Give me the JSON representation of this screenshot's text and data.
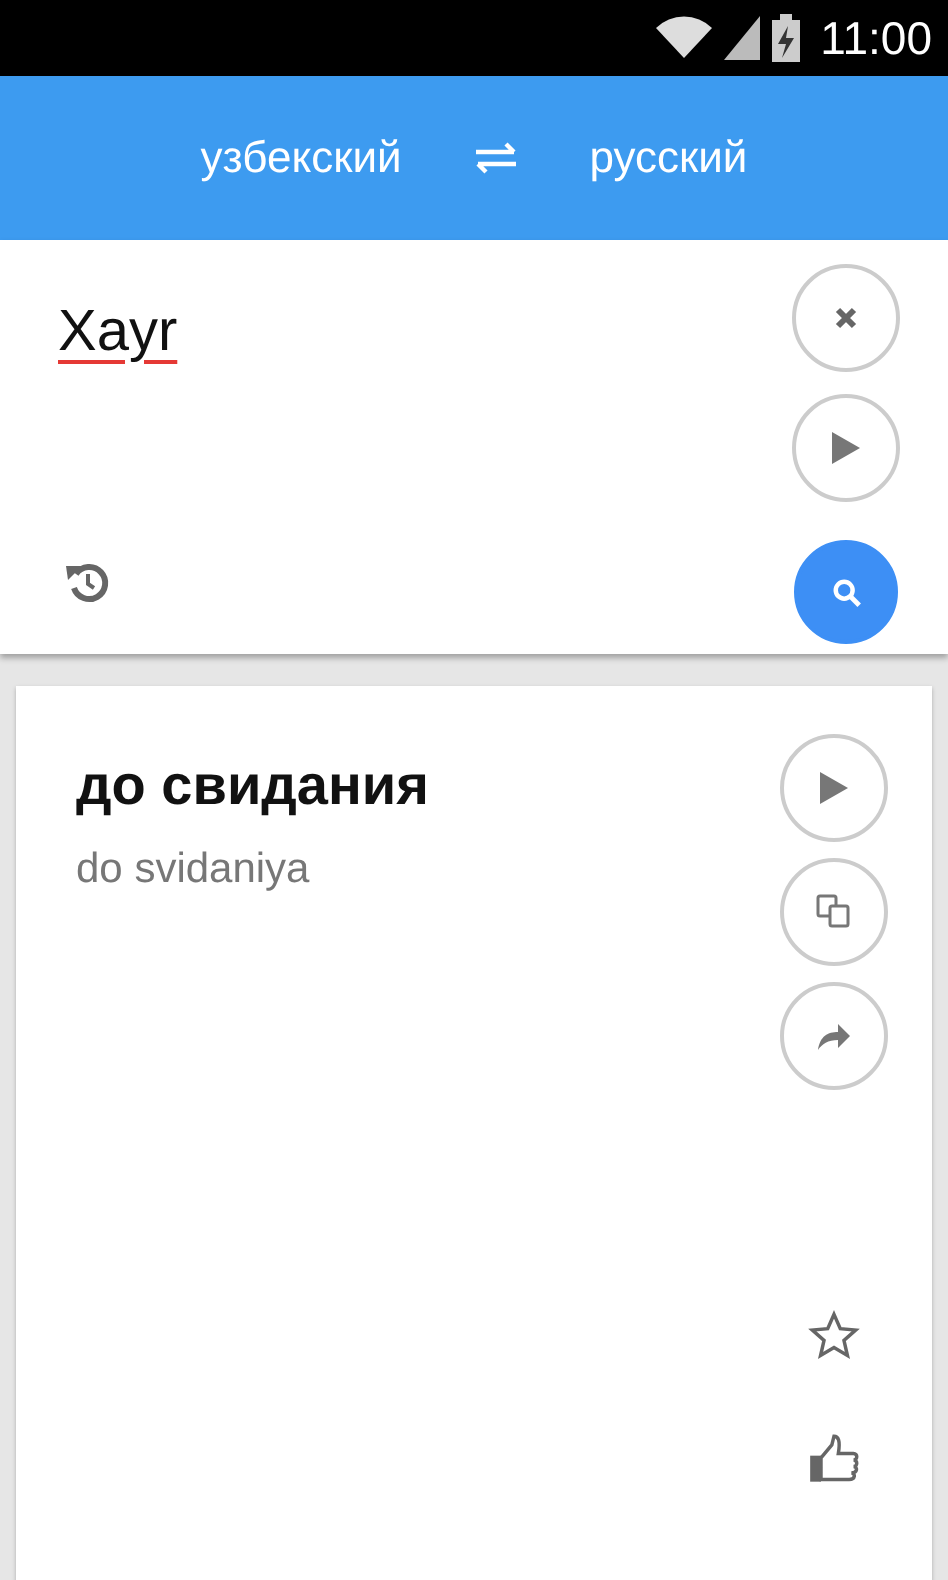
{
  "status_bar": {
    "time": "11:00"
  },
  "languages": {
    "source": "узбекский",
    "target": "русский"
  },
  "input": {
    "value": "Xayr",
    "misspelled": true
  },
  "result": {
    "translation": "до свидания",
    "transliteration": "do svidaniya",
    "favorite": false
  }
}
